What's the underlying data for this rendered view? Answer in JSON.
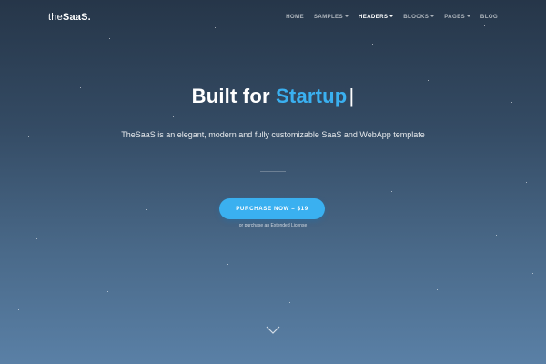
{
  "brand": {
    "logo_prefix": "the",
    "logo_name": "SaaS."
  },
  "nav": {
    "items": [
      {
        "label": "HOME",
        "dropdown": false,
        "active": false
      },
      {
        "label": "SAMPLES",
        "dropdown": true,
        "active": false
      },
      {
        "label": "HEADERS",
        "dropdown": true,
        "active": true
      },
      {
        "label": "BLOCKS",
        "dropdown": true,
        "active": false
      },
      {
        "label": "PAGES",
        "dropdown": true,
        "active": false
      },
      {
        "label": "BLOG",
        "dropdown": false,
        "active": false
      }
    ]
  },
  "hero": {
    "title_prefix": "Built for",
    "title_accent": "Startup",
    "cursor": "|",
    "subtitle": "TheSaaS is an elegant, modern and fully customizable SaaS and WebApp template",
    "cta_label": "PURCHASE NOW – $19",
    "cta_note": "or purchase an Extended License"
  },
  "icons": {
    "scroll": "chevron-down-icon",
    "dropdown": "caret-down-icon"
  },
  "colors": {
    "accent": "#3ab0f0",
    "background_top": "#263649",
    "background_bottom": "#5a80a6"
  }
}
